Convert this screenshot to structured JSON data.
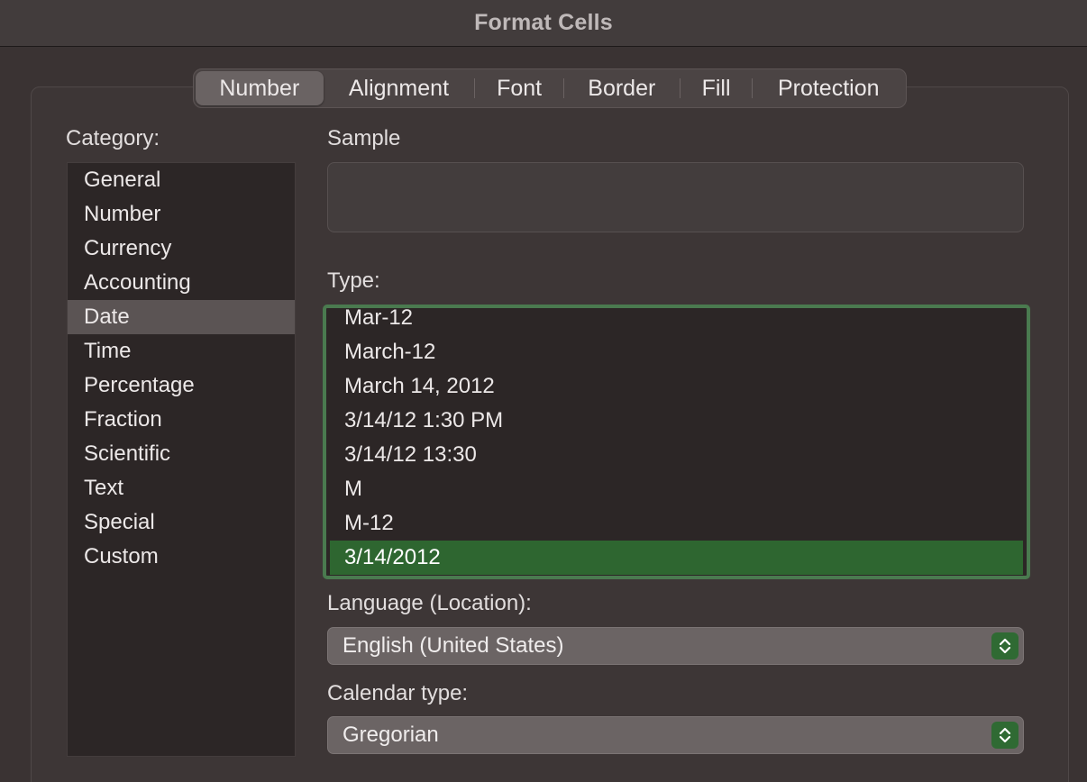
{
  "window": {
    "title": "Format Cells"
  },
  "tabs": [
    {
      "label": "Number",
      "active": true
    },
    {
      "label": "Alignment"
    },
    {
      "label": "Font"
    },
    {
      "label": "Border"
    },
    {
      "label": "Fill"
    },
    {
      "label": "Protection"
    }
  ],
  "category": {
    "label": "Category:",
    "items": [
      "General",
      "Number",
      "Currency",
      "Accounting",
      "Date",
      "Time",
      "Percentage",
      "Fraction",
      "Scientific",
      "Text",
      "Special",
      "Custom"
    ],
    "selected": "Date"
  },
  "sample": {
    "label": "Sample",
    "value": ""
  },
  "type": {
    "label": "Type:",
    "items": [
      "Mar-12",
      "March-12",
      "March 14, 2012",
      "3/14/12 1:30 PM",
      "3/14/12 13:30",
      "M",
      "M-12",
      "3/14/2012"
    ],
    "selected": "3/14/2012"
  },
  "language": {
    "label": "Language (Location):",
    "value": "English (United States)"
  },
  "calendar": {
    "label": "Calendar type:",
    "value": "Gregorian"
  },
  "colors": {
    "accent": "#2e6630",
    "focus_ring": "#4a7a4f"
  },
  "icons": {
    "stepper": "chevron-up-down-icon"
  }
}
